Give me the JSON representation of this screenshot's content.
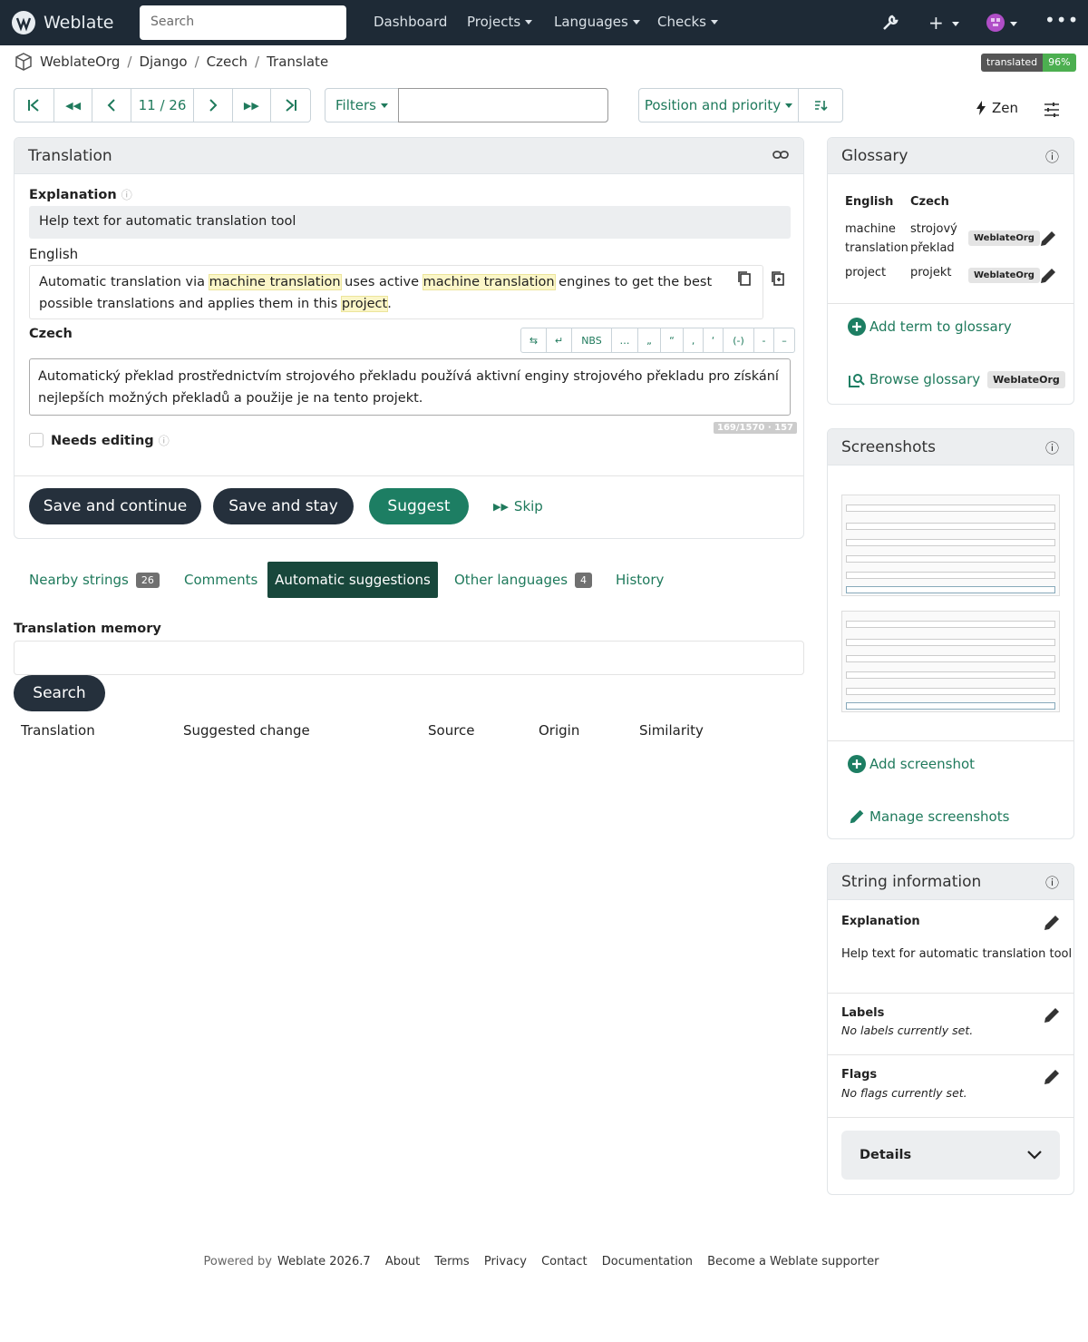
{
  "nav": {
    "brand": "Weblate",
    "search_placeholder": "Search",
    "links": [
      "Dashboard",
      "Projects",
      "Languages",
      "Checks"
    ]
  },
  "breadcrumb": [
    "WeblateOrg",
    "Django",
    "Czech",
    "Translate"
  ],
  "status_badge": {
    "label": "translated",
    "value": "96%"
  },
  "toolbar": {
    "position": "11 / 26",
    "filters": "Filters",
    "sort": "Position and priority",
    "zen": "Zen"
  },
  "translation": {
    "title": "Translation",
    "explanation_label": "Explanation",
    "explanation_text": "Help text for automatic translation tool",
    "source_lang": "English",
    "source_parts": [
      "Automatic translation via ",
      "machine translation",
      " uses active ",
      "machine translation",
      " engines to get the best possible translations and applies them in this ",
      "project",
      "."
    ],
    "target_lang": "Czech",
    "target_text": "Automatický překlad prostřednictvím strojového překladu používá aktivní enginy strojového překladu pro získání nejlepších možných překladů a použije je na tento projekt.",
    "char_buttons": [
      "⇆",
      "↵",
      "NBS",
      "…",
      "„",
      "“",
      "‚",
      "‘",
      "(-)",
      "-",
      "–"
    ],
    "counter": "169/1570 · 157",
    "needs_editing": "Needs editing",
    "save_continue": "Save and continue",
    "save_stay": "Save and stay",
    "suggest": "Suggest",
    "skip": "Skip"
  },
  "tabs": [
    {
      "label": "Nearby strings",
      "count": "26"
    },
    {
      "label": "Comments",
      "count": ""
    },
    {
      "label": "Automatic suggestions",
      "count": ""
    },
    {
      "label": "Other languages",
      "count": "4"
    },
    {
      "label": "History",
      "count": ""
    }
  ],
  "memory": {
    "title": "Translation memory",
    "search_button": "Search",
    "columns": [
      "Translation",
      "Suggested change",
      "Source",
      "Origin",
      "Similarity"
    ]
  },
  "glossary": {
    "title": "Glossary",
    "col_en": "English",
    "col_cs": "Czech",
    "rows": [
      {
        "en": "machine translation",
        "cs": "strojový překlad",
        "chip": "WeblateOrg"
      },
      {
        "en": "project",
        "cs": "projekt",
        "chip": "WeblateOrg"
      }
    ],
    "add_term": "Add term to glossary",
    "browse": "Browse glossary",
    "browse_chip": "WeblateOrg"
  },
  "screenshots": {
    "title": "Screenshots",
    "add": "Add screenshot",
    "manage": "Manage screenshots"
  },
  "string_info": {
    "title": "String information",
    "explanation_label": "Explanation",
    "explanation_text": "Help text for automatic translation tool",
    "labels_label": "Labels",
    "labels_text": "No labels currently set.",
    "flags_label": "Flags",
    "flags_text": "No flags currently set.",
    "details": "Details"
  },
  "footer": {
    "powered_prefix": "Powered by",
    "powered_link": "Weblate 2026.7",
    "links": [
      "About",
      "Terms",
      "Privacy",
      "Contact",
      "Documentation",
      "Become a Weblate supporter"
    ]
  },
  "colors": {
    "navbar": "#1e2a36",
    "accent": "#1f7a5c",
    "badge_green": "#4caf50"
  }
}
